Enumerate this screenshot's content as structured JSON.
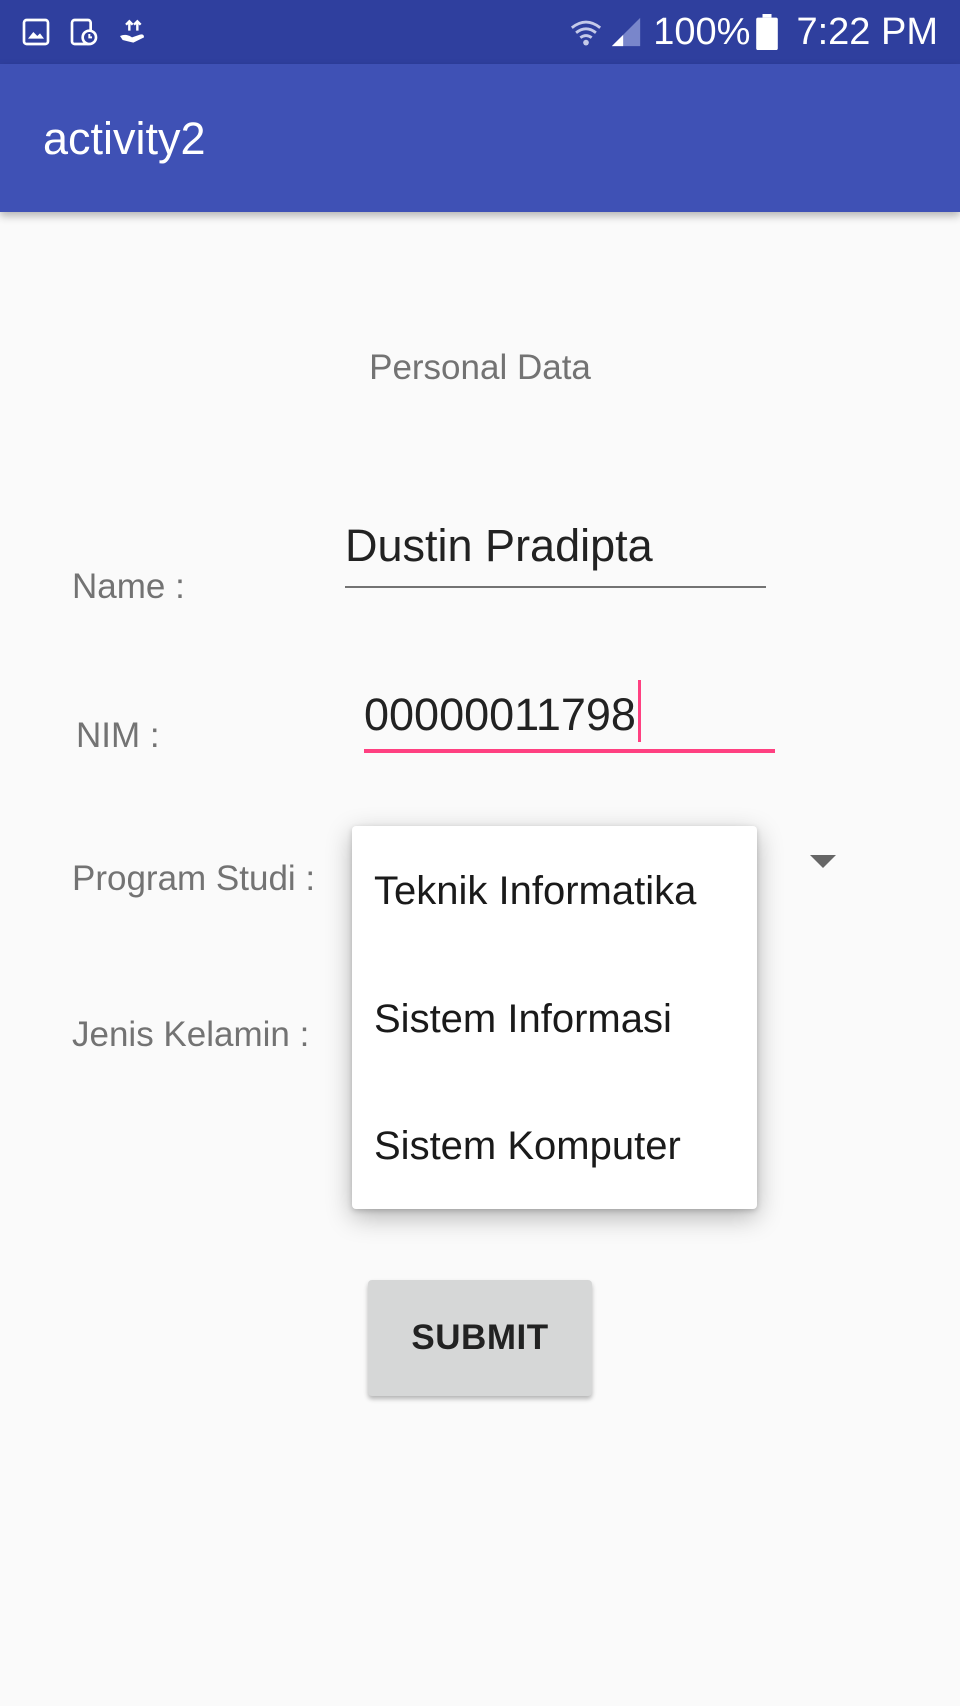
{
  "status_bar": {
    "left_icons": [
      "gallery-icon",
      "calendar-clock-icon",
      "upload-icon"
    ],
    "battery_level": "100%",
    "time": "7:22 PM"
  },
  "app_bar": {
    "title": "activity2"
  },
  "form": {
    "section_title": "Personal Data",
    "name_label": "Name :",
    "name_value": "Dustin Pradipta",
    "nim_label": "NIM :",
    "nim_value": "00000011798",
    "program_label": "Program Studi :",
    "gender_label": "Jenis Kelamin :",
    "submit_label": "SUBMIT"
  },
  "program_dropdown": {
    "options": [
      "Teknik Informatika",
      "Sistem Informasi",
      "Sistem Komputer"
    ]
  },
  "colors": {
    "status_bar": "#2f3f9e",
    "app_bar": "#3f51b5",
    "accent": "#ff4081",
    "background": "#fafafa"
  }
}
